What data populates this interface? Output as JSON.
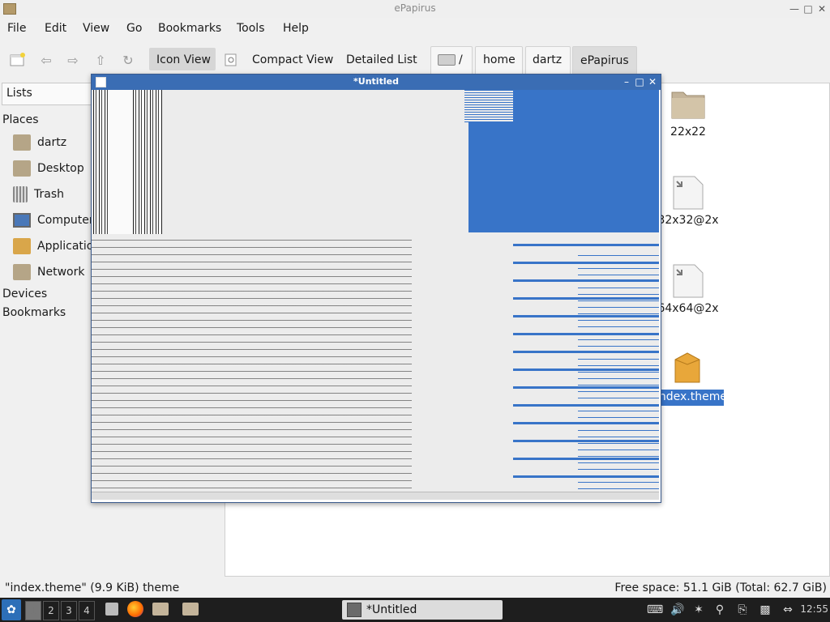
{
  "window": {
    "title": "ePapirus"
  },
  "menu": [
    "File",
    "Edit",
    "View",
    "Go",
    "Bookmarks",
    "Tools",
    "Help"
  ],
  "toolbar": {
    "icon_view": "Icon View",
    "compact_view": "Compact View",
    "detailed_list": "Detailed List",
    "path_root": "/",
    "path": [
      "home",
      "dartz",
      "ePapirus"
    ]
  },
  "sidebar": {
    "selector": "Lists",
    "places_header": "Places",
    "places": [
      "dartz",
      "Desktop",
      "Trash",
      "Computer",
      "Applications",
      "Network"
    ],
    "devices_header": "Devices",
    "bookmarks_header": "Bookmarks"
  },
  "files": [
    {
      "name": "22x22",
      "icon": "folder-icon"
    },
    {
      "name": "32x32@2x",
      "icon": "symlink-file-icon"
    },
    {
      "name": "64x64@2x",
      "icon": "symlink-file-icon"
    },
    {
      "name": "index.theme",
      "icon": "package-icon",
      "selected": true
    }
  ],
  "status": {
    "left": "\"index.theme\" (9.9 KiB) theme",
    "right": "Free space: 51.1 GiB (Total: 62.7 GiB)"
  },
  "editor_window": {
    "title": "*Untitled"
  },
  "taskbar": {
    "workspaces": [
      "1",
      "2",
      "3",
      "4"
    ],
    "active_task": "*Untitled",
    "clock": "12:55"
  },
  "colors": {
    "accent": "#3a6db4",
    "selection": "#3874c8"
  }
}
